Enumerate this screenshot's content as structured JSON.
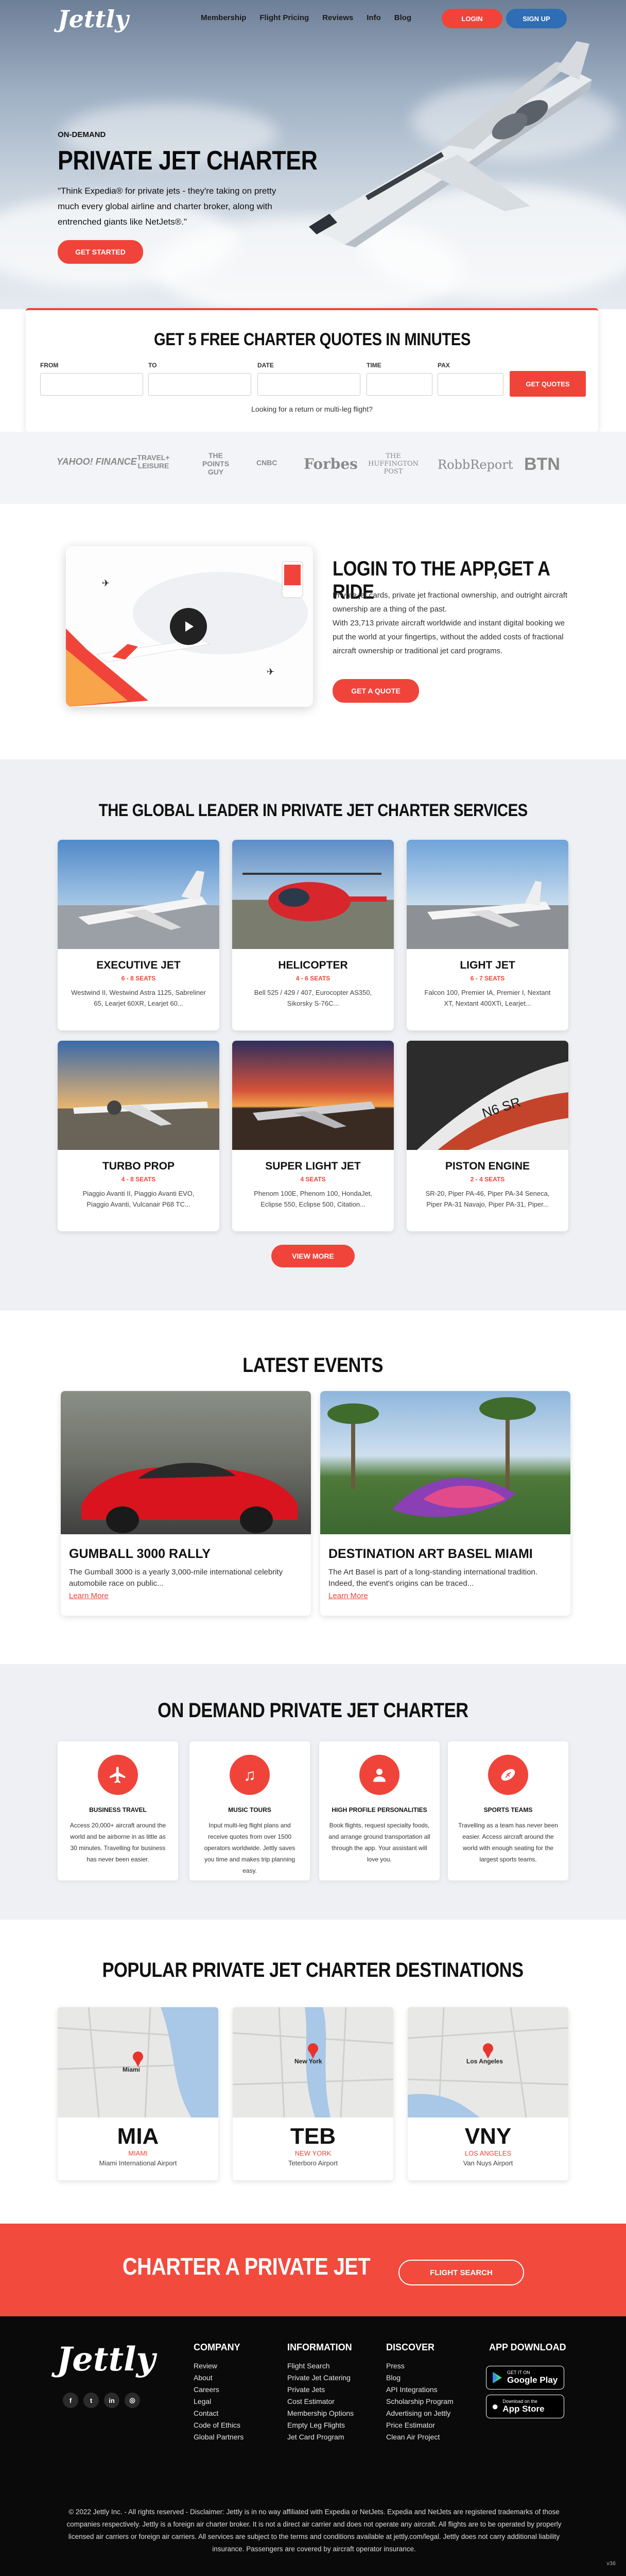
{
  "header": {
    "logo": "Jettly",
    "nav": [
      "Membership",
      "Flight Pricing",
      "Reviews",
      "Info",
      "Blog"
    ],
    "login": "LOGIN",
    "signup": "SIGN UP"
  },
  "hero": {
    "eyebrow": "ON-DEMAND",
    "title": "PRIVATE JET CHARTER",
    "quote": "\"Think Expedia® for private jets - they're taking on pretty much every global airline and charter broker, along with entrenched giants like NetJets®.\"",
    "cta": "GET STARTED"
  },
  "quote_form": {
    "title": "GET 5 FREE CHARTER QUOTES IN MINUTES",
    "labels": [
      "FROM",
      "TO",
      "DATE",
      "TIME",
      "PAX"
    ],
    "button": "GET QUOTES",
    "multi": "Looking for a return or multi-leg flight?"
  },
  "press": [
    "YAHOO! FINANCE",
    "TRAVEL+ LEISURE",
    "THE POINTS GUY",
    "CNBC",
    "Forbes",
    "THE HUFFINGTON POST",
    "RobbReport",
    "BTN"
  ],
  "app": {
    "title": "LOGIN TO THE APP,GET A RIDE",
    "p1": "Private jet cards, private jet fractional ownership, and outright aircraft ownership are a thing of the past.",
    "p2": "With 23,713 private aircraft worldwide and instant digital booking we put the world at your fingertips, without the added costs of fractional aircraft ownership or traditional jet card programs.",
    "cta": "GET A QUOTE"
  },
  "services": {
    "title": "THE GLOBAL LEADER IN PRIVATE JET CHARTER SERVICES",
    "cards": [
      {
        "title": "EXECUTIVE JET",
        "seats": "6 - 8 SEATS",
        "desc": "Westwind II, Westwind Astra 1125, Sabreliner 65, Learjet 60XR, Learjet 60..."
      },
      {
        "title": "HELICOPTER",
        "seats": "4 - 6 SEATS",
        "desc": "Bell 525 / 429 / 407, Eurocopter AS350, Sikorsky S-76C..."
      },
      {
        "title": "LIGHT JET",
        "seats": "6 - 7 SEATS",
        "desc": "Falcon 100, Premier IA, Premier I, Nextant XT, Nextant 400XTi, Learjet..."
      },
      {
        "title": "TURBO PROP",
        "seats": "4 - 8 SEATS",
        "desc": "Piaggio Avanti II, Piaggio Avanti EVO, Piaggio Avanti, Vulcanair P68 TC..."
      },
      {
        "title": "SUPER LIGHT JET",
        "seats": "4 SEATS",
        "desc": "Phenom 100E, Phenom 100, HondaJet, Eclipse 550, Eclipse 500, Citation..."
      },
      {
        "title": "PISTON ENGINE",
        "seats": "2 - 4 SEATS",
        "desc": "SR-20, Piper PA-46, Piper PA-34 Seneca, Piper PA-31 Navajo, Piper PA-31, Piper..."
      }
    ],
    "more": "VIEW MORE"
  },
  "events": {
    "title": "LATEST EVENTS",
    "items": [
      {
        "title": "GUMBALL 3000 RALLY",
        "desc": "The Gumball 3000 is a yearly 3,000-mile international celebrity automobile race on public...",
        "link": "Learn More"
      },
      {
        "title": "DESTINATION ART BASEL MIAMI",
        "desc": "The Art Basel is part of a long-standing international tradition. Indeed, the event's origins can be traced...",
        "link": "Learn More"
      }
    ]
  },
  "ondemand": {
    "title": "ON DEMAND PRIVATE JET CHARTER",
    "items": [
      {
        "icon": "plane-icon",
        "title": "BUSINESS TRAVEL",
        "desc": "Access 20,000+ aircraft around the world and be airborne in as little as 30 minutes. Travelling for business has never been easier."
      },
      {
        "icon": "music-icon",
        "title": "MUSIC TOURS",
        "desc": "Input multi-leg flight plans and receive quotes from over 1500 operators worldwide. Jettly saves you time and makes trip planning easy."
      },
      {
        "icon": "person-icon",
        "title": "HIGH PROFILE PERSONALITIES",
        "desc": "Book flights, request specialty foods, and arrange ground transportation all through the app. Your assistant will love you."
      },
      {
        "icon": "football-icon",
        "title": "SPORTS TEAMS",
        "desc": "Travelling as a team has never been easier. Access aircraft around the world with enough seating for the largest sports teams."
      }
    ]
  },
  "destinations": {
    "title": "POPULAR PRIVATE JET CHARTER DESTINATIONS",
    "items": [
      {
        "code": "MIA",
        "city": "MIAMI",
        "airport": "Miami International Airport",
        "map_label": "Miami"
      },
      {
        "code": "TEB",
        "city": "NEW YORK",
        "airport": "Teterboro Airport",
        "map_label": "New York"
      },
      {
        "code": "VNY",
        "city": "LOS ANGELES",
        "airport": "Van Nuys Airport",
        "map_label": "Los Angeles"
      }
    ]
  },
  "cta": {
    "title": "CHARTER A PRIVATE JET",
    "button": "FLIGHT SEARCH"
  },
  "footer": {
    "logo": "Jettly",
    "columns": [
      {
        "heading": "COMPANY",
        "items": [
          "Review",
          "About",
          "Careers",
          "Legal",
          "Contact",
          "Code of Ethics",
          "Global Partners"
        ]
      },
      {
        "heading": "INFORMATION",
        "items": [
          "Flight Search",
          "Private Jet Catering",
          "Private Jets",
          "Cost Estimator",
          "Membership Options",
          "Empty Leg Flights",
          "Jet Card Program"
        ]
      },
      {
        "heading": "DISCOVER",
        "items": [
          "Press",
          "Blog",
          "API Integrations",
          "Scholarship Program",
          "Advertising on Jettly",
          "Price Estimator",
          "Clean Air Project"
        ]
      }
    ],
    "app_heading": "APP DOWNLOAD",
    "google_small": "GET IT ON",
    "google_big": "Google Play",
    "apple_small": "Download on the",
    "apple_big": "App Store",
    "legal": "© 2022 Jettly Inc. - All rights reserved - Disclaimer: Jettly is in no way affiliated with Expedia or NetJets. Expedia and NetJets are registered trademarks of those companies respectively. Jettly is a foreign air charter broker. It is not a direct air carrier and does not operate any aircraft. All flights are to be operated by properly licensed air carriers or foreign air carriers. All services are subject to the terms and conditions available at jettly.com/legal. Jettly does not carry additional liability insurance. Passengers are covered by aircraft operator insurance.",
    "version": "v36"
  },
  "colors": {
    "accent": "#f0443a",
    "signup": "#2f6db5",
    "footer": "#0a0a0a"
  }
}
